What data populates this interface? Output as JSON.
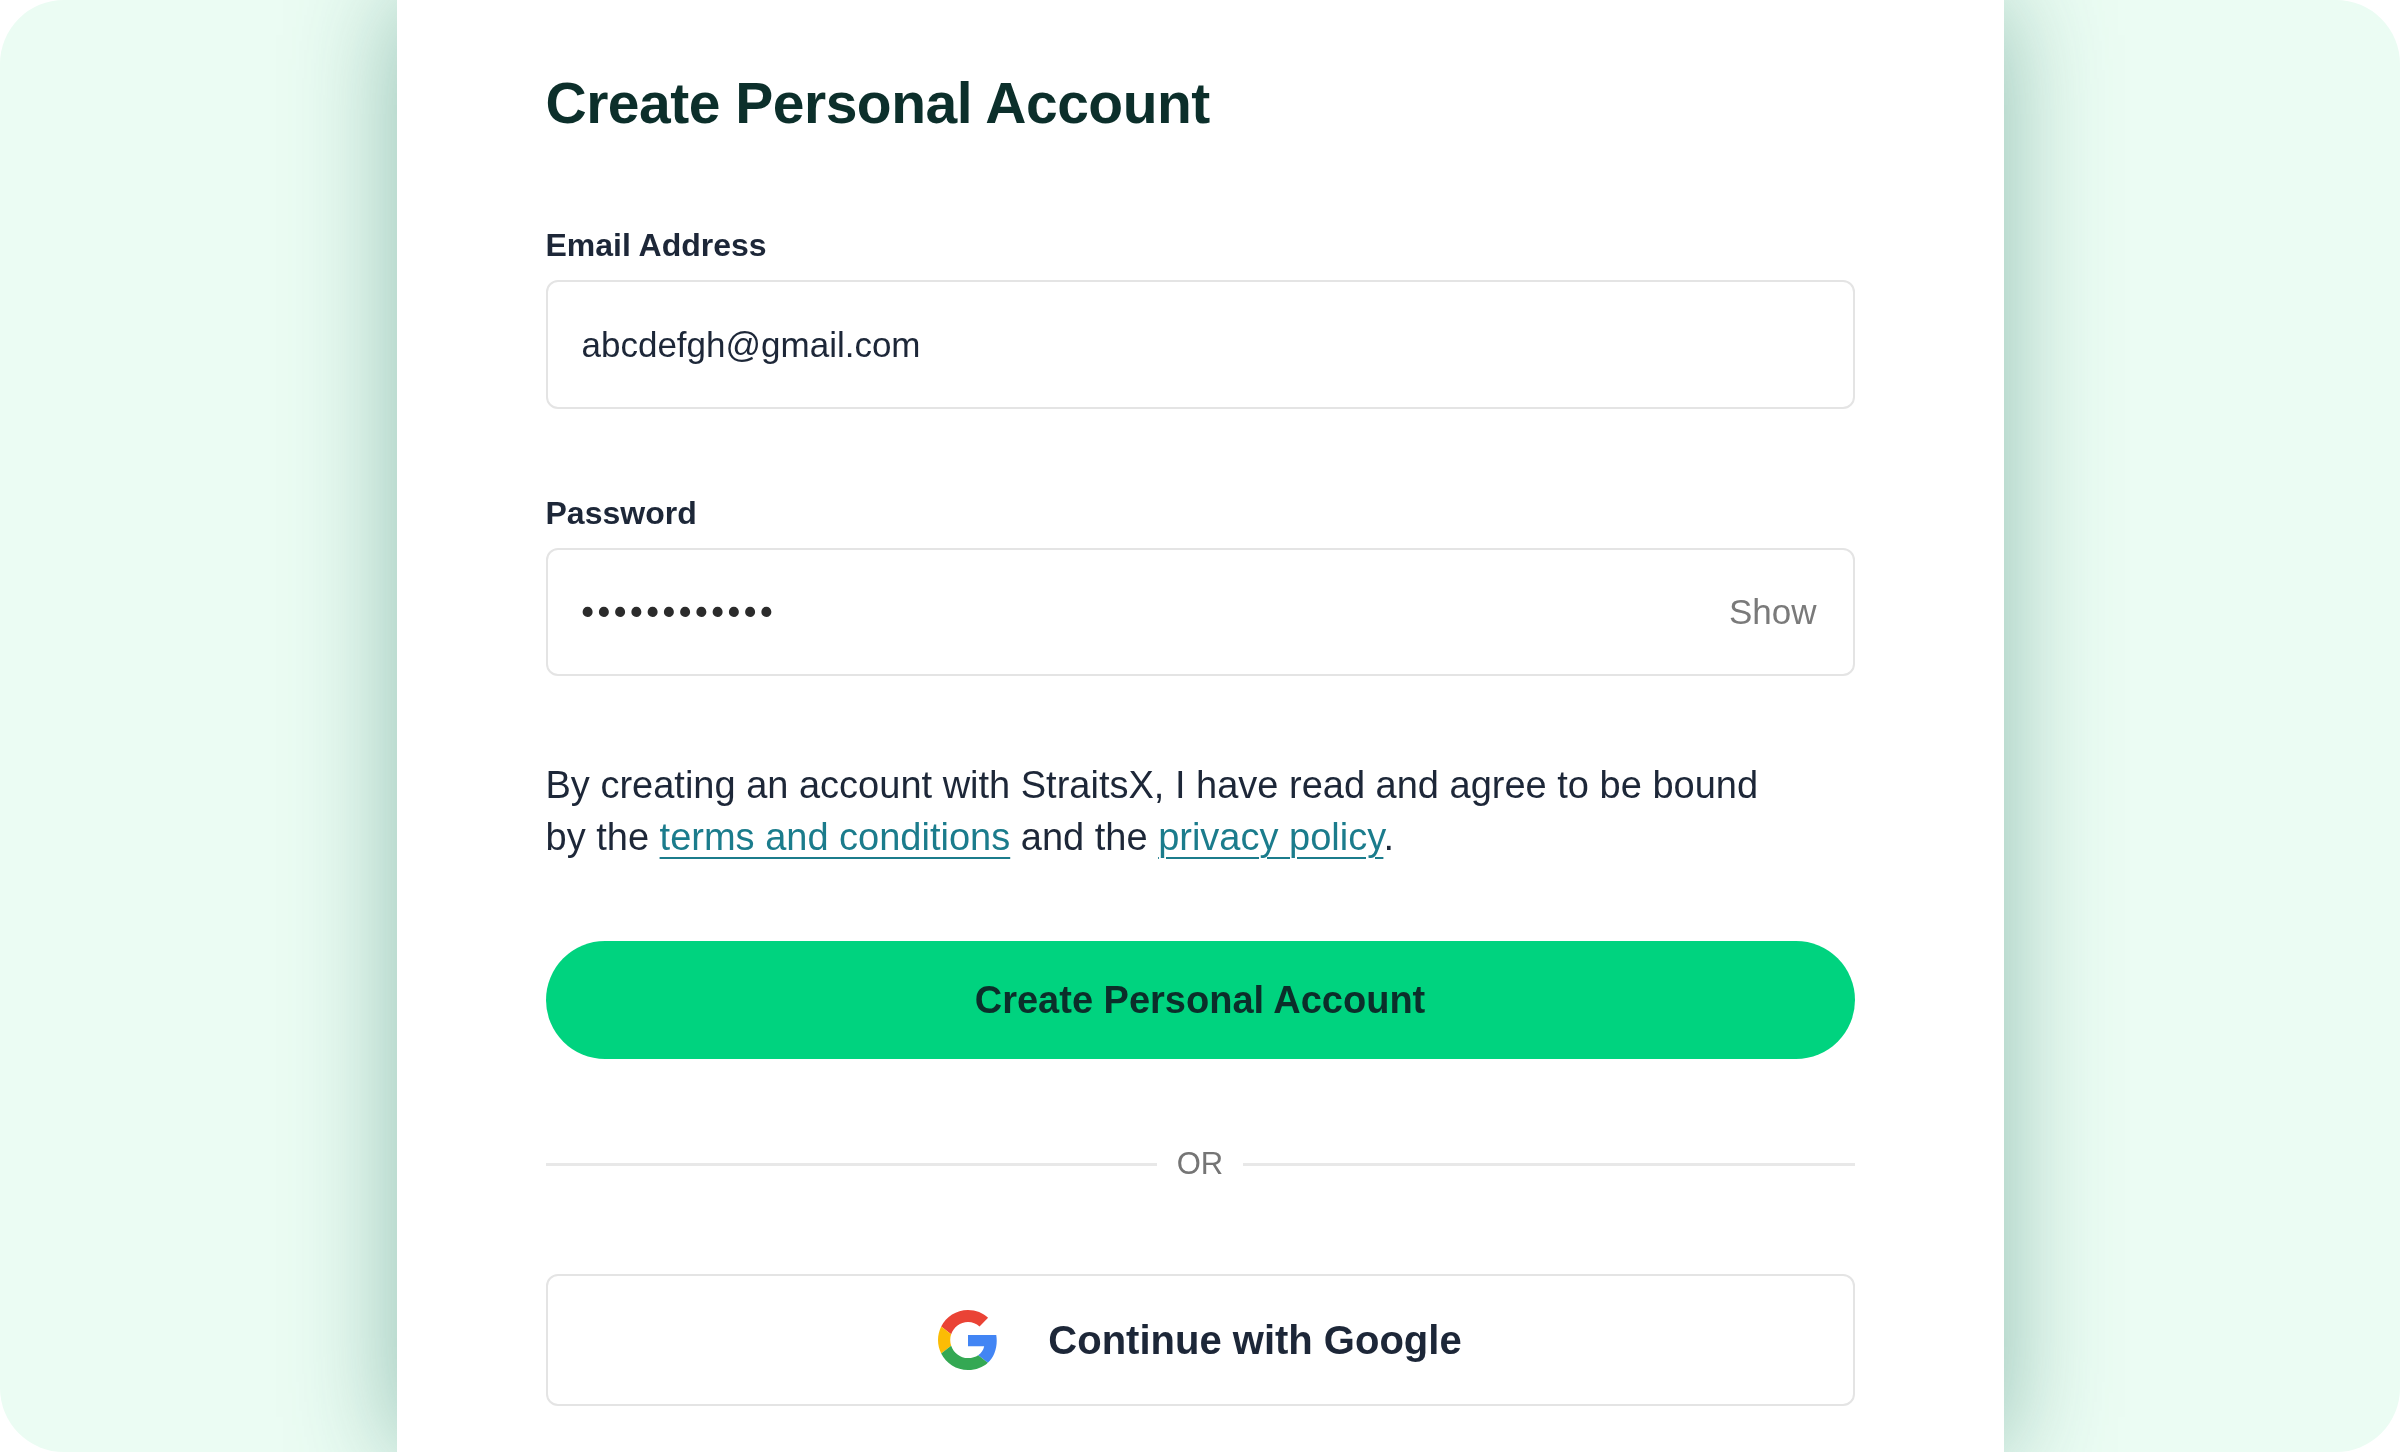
{
  "title": "Create Personal Account",
  "fields": [
    {
      "kind": "email",
      "label": "Email Address",
      "value": "abcdefgh@gmail.com"
    },
    {
      "kind": "password",
      "label": "Password",
      "value": "••••••••••••",
      "toggle": "Show"
    }
  ],
  "agreement": [
    {
      "kind": "text",
      "text": "By creating an account with StraitsX, I have read and agree to be bound by the "
    },
    {
      "kind": "link",
      "text": "terms and conditions"
    },
    {
      "kind": "text",
      "text": " and the "
    },
    {
      "kind": "link",
      "text": "privacy policy"
    },
    {
      "kind": "text",
      "text": "."
    }
  ],
  "submit_button": "Create Personal Account",
  "divider": "OR",
  "google_button": "Continue with Google"
}
